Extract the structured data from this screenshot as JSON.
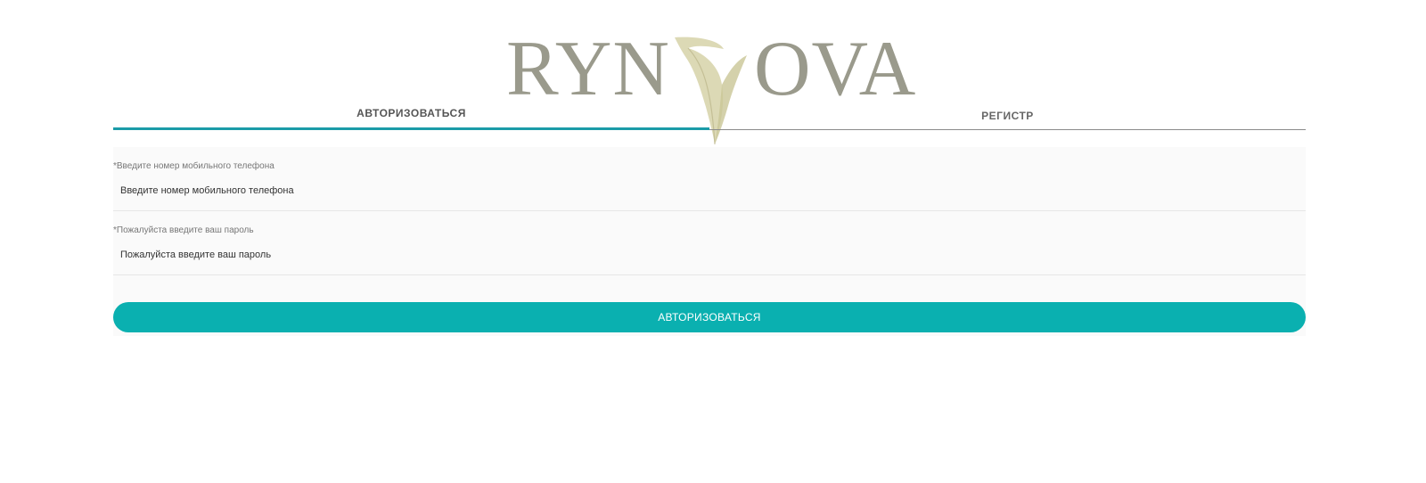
{
  "brand": {
    "logo_text_left": "RYN",
    "logo_text_right": "OVA",
    "logo_color": "#9a9a8c",
    "leaf_color": "#d6d2a8"
  },
  "tabs": [
    {
      "label": "АВТОРИЗОВАТЬСЯ",
      "active": true
    },
    {
      "label": "РЕГИСТР",
      "active": false
    }
  ],
  "form": {
    "phone_label": "*Введите номер мобильного телефона",
    "phone_placeholder": "Введите номер мобильного телефона",
    "password_label": "*Пожалуйста введите ваш пароль",
    "password_placeholder": "Пожалуйста введите ваш пароль",
    "submit_label": "АВТОРИЗОВАТЬСЯ"
  },
  "colors": {
    "accent": "#1a9ba8",
    "button": "#0ab0b0"
  }
}
